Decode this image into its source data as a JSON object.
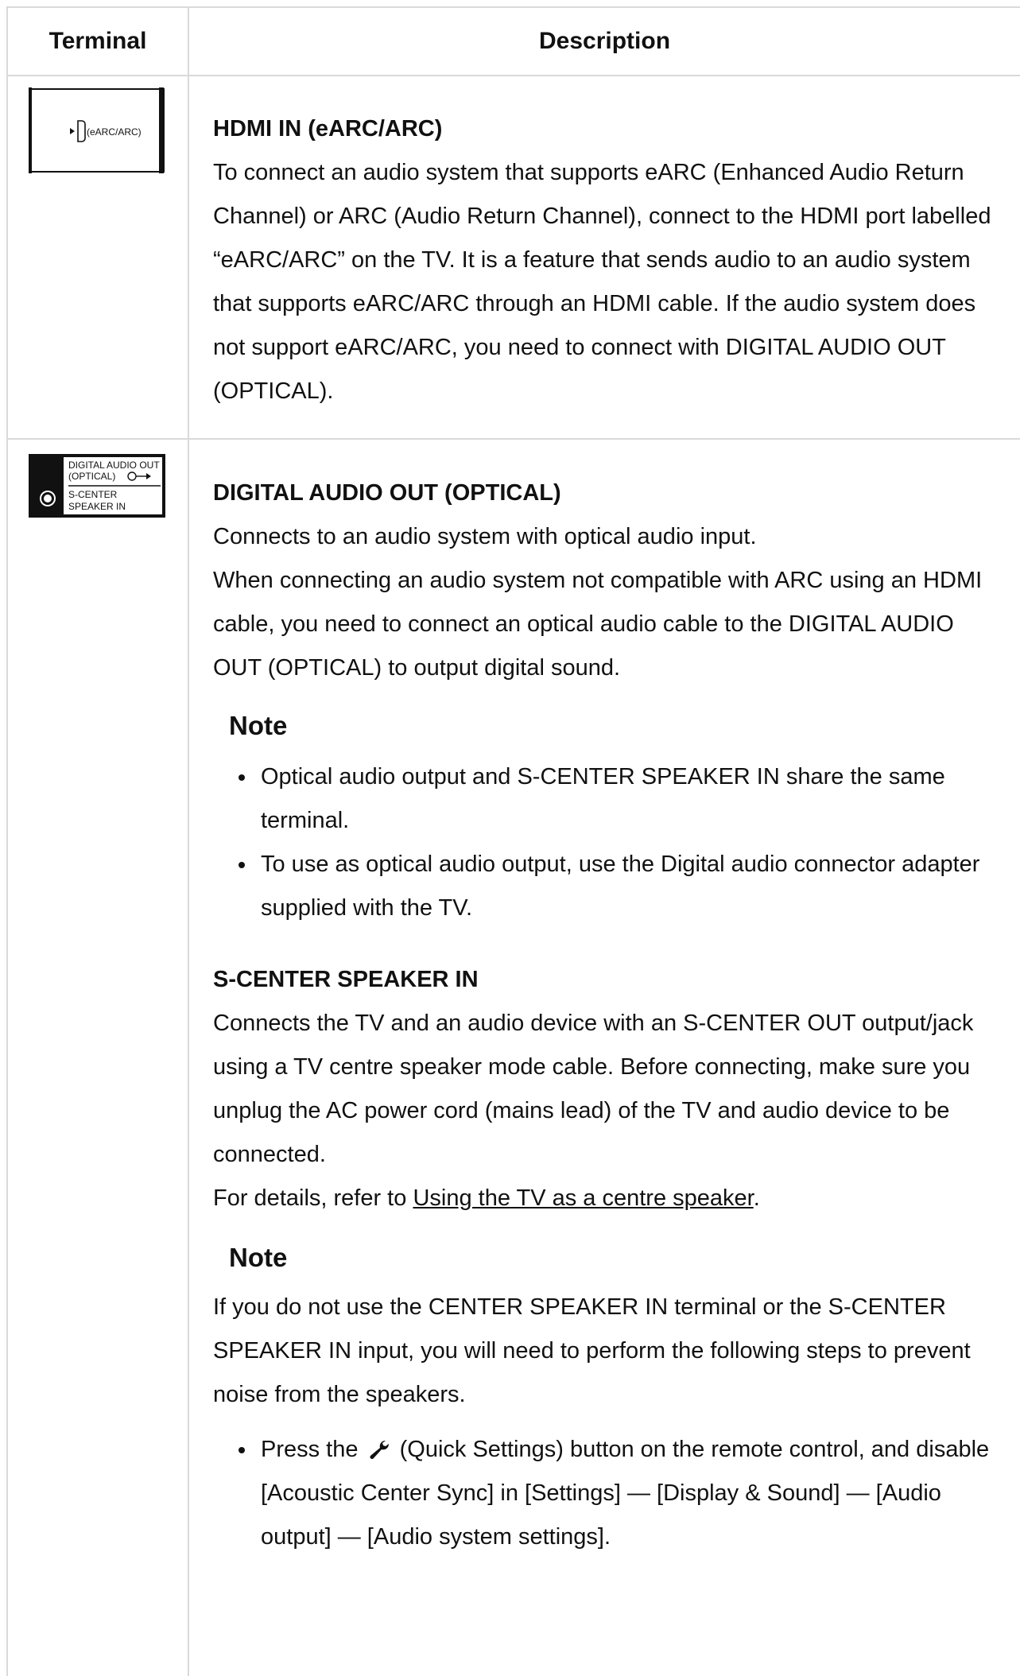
{
  "table": {
    "headers": {
      "terminal": "Terminal",
      "description": "Description"
    }
  },
  "hdmi": {
    "icon_text": "(eARC/ARC)",
    "heading": "HDMI IN (eARC/ARC)",
    "text": "To connect an audio system that supports eARC (Enhanced Audio Return Channel) or ARC (Audio Return Channel), connect to the HDMI port labelled “eARC/ARC” on the TV. It is a feature that sends audio to an audio system that supports eARC/ARC through an HDMI cable. If the audio system does not support eARC/ARC, you need to connect with DIGITAL AUDIO OUT (OPTICAL)."
  },
  "optical": {
    "icon_line1": "DIGITAL AUDIO OUT",
    "icon_line2": "(OPTICAL)",
    "icon_line3": "S-CENTER",
    "icon_line4": "SPEAKER IN",
    "heading": "DIGITAL AUDIO OUT (OPTICAL)",
    "text1": "Connects to an audio system with optical audio input.",
    "text2": "When connecting an audio system not compatible with ARC using an HDMI cable, you need to connect an optical audio cable to the DIGITAL AUDIO OUT (OPTICAL) to output digital sound.",
    "note_title": "Note",
    "notes": [
      "Optical audio output and S-CENTER SPEAKER IN share the same terminal.",
      "To use as optical audio output, use the Digital audio connector adapter supplied with the TV."
    ]
  },
  "scenter": {
    "heading": "S-CENTER SPEAKER IN",
    "text": "Connects the TV and an audio device with an S-CENTER OUT output/jack using a TV centre speaker mode cable. Before connecting, make sure you unplug the AC power cord (mains lead) of the TV and audio device to be connected.",
    "ref_prefix": "For details, refer to ",
    "ref_link": "Using the TV as a centre speaker",
    "ref_suffix": ".",
    "note_title": "Note",
    "note_text": "If you do not use the CENTER SPEAKER IN terminal or the S-CENTER SPEAKER IN input, you will need to perform the following steps to prevent noise from the speakers.",
    "step_prefix": "Press the ",
    "step_suffix": " (Quick Settings) button on the remote control, and disable [Acoustic Center Sync] in [Settings] — [Display & Sound] — [Audio output] — [Audio system settings]."
  }
}
